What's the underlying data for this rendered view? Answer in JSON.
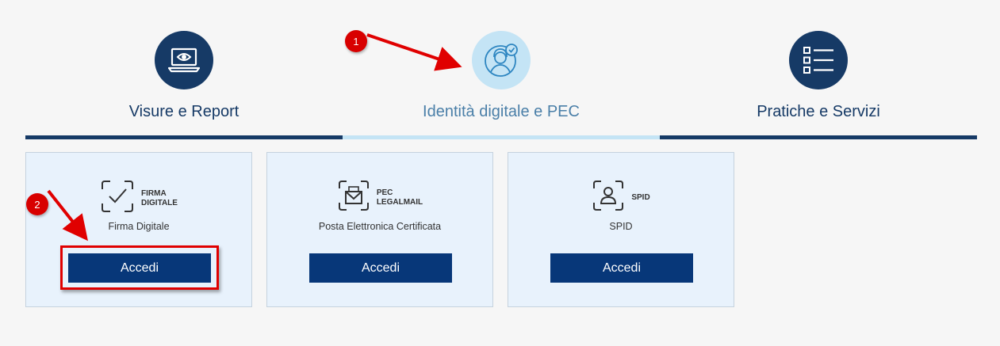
{
  "tabs": [
    {
      "label": "Visure e Report",
      "icon": "laptop-eye-icon",
      "active": false
    },
    {
      "label": "Identità digitale e PEC",
      "icon": "digital-identity-icon",
      "active": true
    },
    {
      "label": "Pratiche e Servizi",
      "icon": "checklist-icon",
      "active": false
    }
  ],
  "cards": [
    {
      "brand": "FIRMA\nDIGITALE",
      "icon": "checkmark-box-icon",
      "description": "Firma Digitale",
      "button": "Accedi"
    },
    {
      "brand": "PEC\nLEGALMAIL",
      "icon": "mail-box-icon",
      "description": "Posta Elettronica Certificata",
      "button": "Accedi"
    },
    {
      "brand": "SPID",
      "icon": "person-box-icon",
      "description": "SPID",
      "button": "Accedi"
    }
  ],
  "annotations": [
    {
      "number": "1",
      "icon": "red-arrow-icon"
    },
    {
      "number": "2",
      "icon": "red-arrow-icon"
    }
  ],
  "colors": {
    "primary": "#163a66",
    "button": "#073779",
    "active_tab": "#c4e4f5",
    "card_bg": "#e8f2fc",
    "annotation_red": "#d80000"
  }
}
